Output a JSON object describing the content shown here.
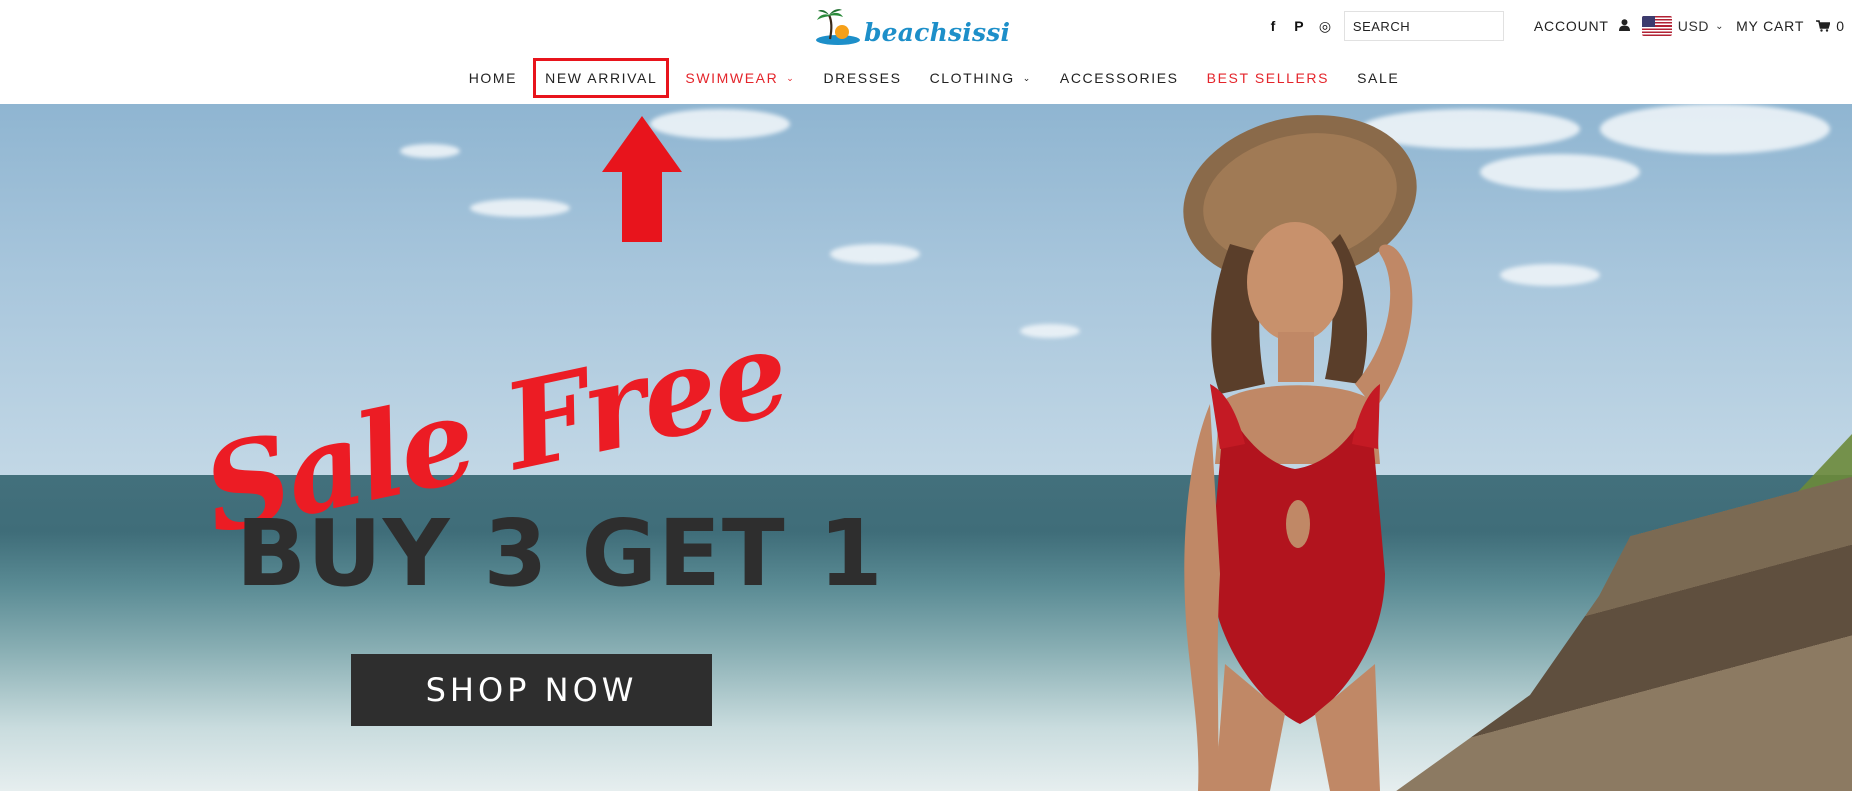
{
  "brand": {
    "name": "beachsissi"
  },
  "utility": {
    "social": [
      {
        "icon": "facebook-icon",
        "glyph": "f"
      },
      {
        "icon": "pinterest-icon",
        "glyph": "P"
      },
      {
        "icon": "instagram-icon",
        "glyph": "◎"
      }
    ],
    "search_placeholder": "SEARCH",
    "account_label": "ACCOUNT",
    "currency_label": "USD",
    "cart_label": "MY CART",
    "cart_count": "0"
  },
  "nav": {
    "items": [
      {
        "label": "HOME",
        "red": false,
        "dropdown": false,
        "highlight": false
      },
      {
        "label": "NEW ARRIVAL",
        "red": false,
        "dropdown": false,
        "highlight": true
      },
      {
        "label": "SWIMWEAR",
        "red": true,
        "dropdown": true,
        "highlight": false
      },
      {
        "label": "DRESSES",
        "red": false,
        "dropdown": false,
        "highlight": false
      },
      {
        "label": "CLOTHING",
        "red": false,
        "dropdown": true,
        "highlight": false
      },
      {
        "label": "ACCESSORIES",
        "red": false,
        "dropdown": false,
        "highlight": false
      },
      {
        "label": "BEST SELLERS",
        "red": true,
        "dropdown": false,
        "highlight": false
      },
      {
        "label": "SALE",
        "red": false,
        "dropdown": false,
        "highlight": false
      }
    ]
  },
  "hero": {
    "script_text": "Sale Free",
    "headline": "BUY 3 GET 1",
    "cta_label": "SHOP NOW"
  },
  "colors": {
    "accent_red": "#e4252b",
    "brand_blue": "#1d8fc9",
    "cta_bg": "#2e2e2e",
    "annotation_red": "#e8141c"
  }
}
